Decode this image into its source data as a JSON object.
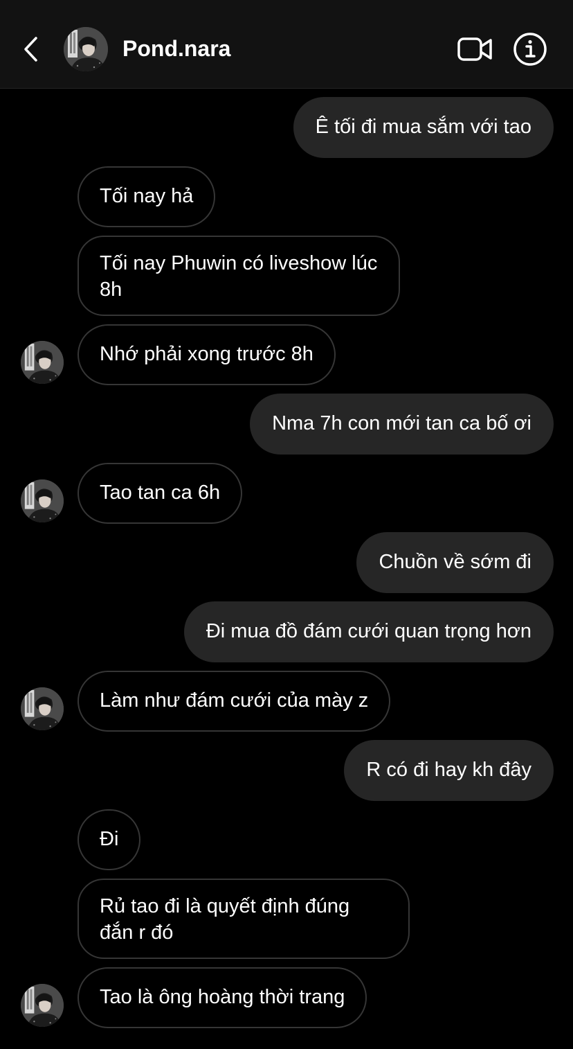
{
  "header": {
    "contact_name": "Pond.nara",
    "back_icon": "chevron-left-icon",
    "video_icon": "video-camera-icon",
    "info_icon": "info-icon"
  },
  "colors": {
    "background": "#000000",
    "header_background": "#121212",
    "outgoing_bubble": "#262626",
    "incoming_border": "#363636",
    "text": "#ffffff"
  },
  "messages": [
    {
      "sender": "me",
      "text": "Ê tối đi mua sắm với tao"
    },
    {
      "sender": "them",
      "text": "Tối nay hả"
    },
    {
      "sender": "them",
      "text": "Tối nay Phuwin có liveshow lúc 8h"
    },
    {
      "sender": "them",
      "text": "Nhớ phải xong trước 8h"
    },
    {
      "sender": "me",
      "text": "Nma 7h con mới tan ca bố ơi"
    },
    {
      "sender": "them",
      "text": "Tao tan ca 6h"
    },
    {
      "sender": "me",
      "text": "Chuồn về sớm đi"
    },
    {
      "sender": "me",
      "text": "Đi mua đồ đám cưới quan trọng hơn"
    },
    {
      "sender": "them",
      "text": "Làm như đám cưới của mày z"
    },
    {
      "sender": "me",
      "text": "R có đi hay kh đây"
    },
    {
      "sender": "them",
      "text": "Đi"
    },
    {
      "sender": "them",
      "text": "Rủ tao đi là quyết định đúng đắn r đó"
    },
    {
      "sender": "them",
      "text": "Tao là ông hoàng thời trang"
    }
  ]
}
